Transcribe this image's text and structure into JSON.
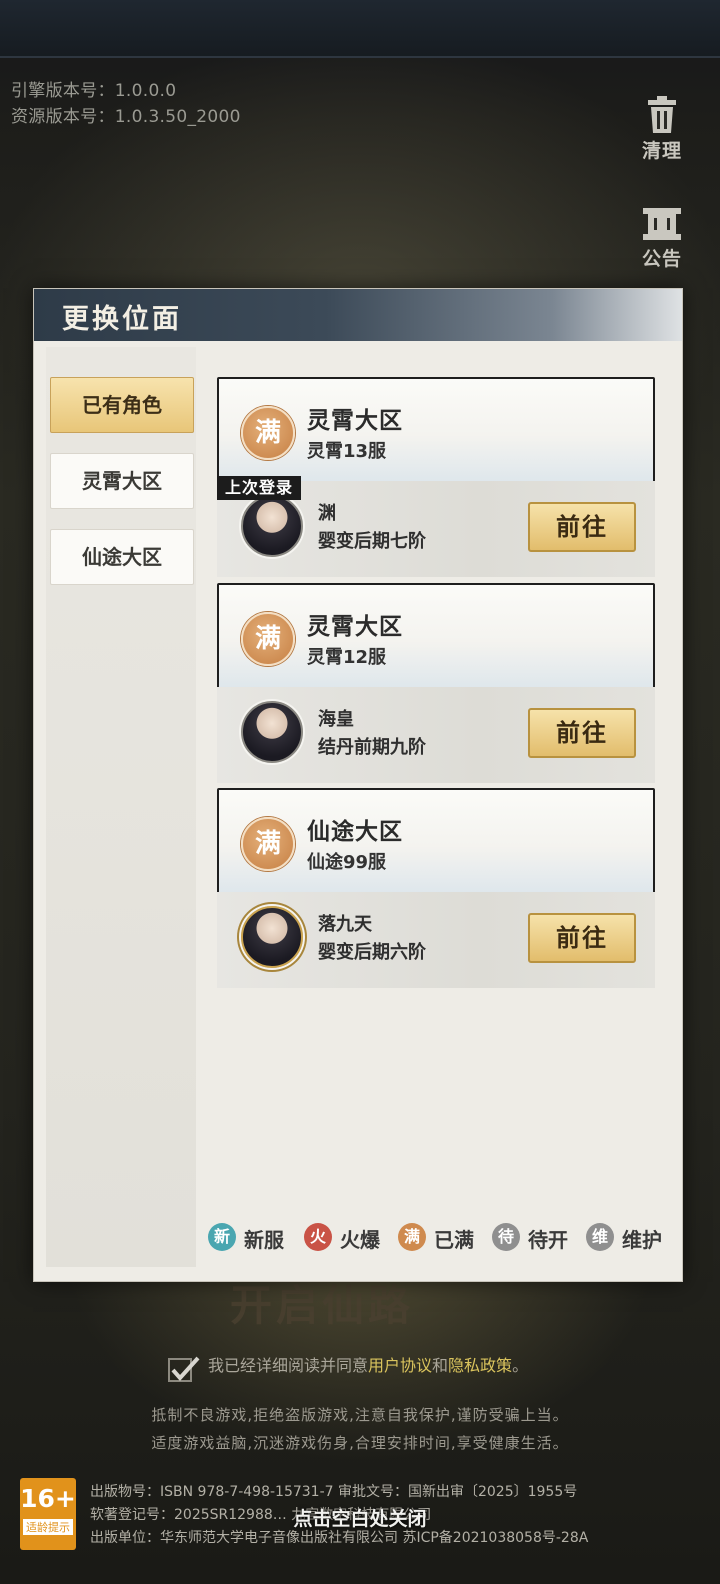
{
  "version": {
    "engine": "引擎版本号：1.0.0.0",
    "resource": "资源版本号：1.0.3.50_2000"
  },
  "side_buttons": {
    "clean": "清理",
    "notice": "公告"
  },
  "dialog": {
    "title": "更换位面",
    "tabs": [
      "已有角色",
      "灵霄大区",
      "仙途大区"
    ],
    "last_login_badge": "上次登录",
    "go_label": "前往",
    "full_badge": "满",
    "cards": [
      {
        "zone": "灵霄大区",
        "server": "灵霄13服",
        "role_name": "渊",
        "role_level": "婴变后期七阶"
      },
      {
        "zone": "灵霄大区",
        "server": "灵霄12服",
        "role_name": "海皇",
        "role_level": "结丹前期九阶"
      },
      {
        "zone": "仙途大区",
        "server": "仙途99服",
        "role_name": "落九天",
        "role_level": "婴变后期六阶"
      }
    ],
    "legend": [
      {
        "badge": "新",
        "label": "新服",
        "color": "#4aa6b0"
      },
      {
        "badge": "火",
        "label": "火爆",
        "color": "#c95346"
      },
      {
        "badge": "满",
        "label": "已满",
        "color": "#cf8a4e"
      },
      {
        "badge": "待",
        "label": "待开",
        "color": "#8f8f8f"
      },
      {
        "badge": "维",
        "label": "维护",
        "color": "#8f8f8f"
      }
    ]
  },
  "background_title": "开启仙路",
  "agreement": {
    "prefix": "我已经详细阅读并同意",
    "link1": "用户协议",
    "mid": "和",
    "link2": "隐私政策",
    "suffix": "。"
  },
  "health_notice": [
    "抵制不良游戏,拒绝盗版游戏,注意自我保护,谨防受骗上当。",
    "适度游戏益脑,沉迷游戏伤身,合理安排时间,享受健康生活。"
  ],
  "age_rating": {
    "big": "16+",
    "small": "适龄提示"
  },
  "publishing": [
    "出版物号：ISBN 978-7-498-15731-7  审批文号：国新出审〔2025〕1955号",
    "软著登记号：2025SR12988…                   九宫数字科技有限公司",
    "出版单位：华东师范大学电子音像出版社有限公司  苏ICP备2021038058号-28A"
  ],
  "close_tip": "点击空白处关闭"
}
